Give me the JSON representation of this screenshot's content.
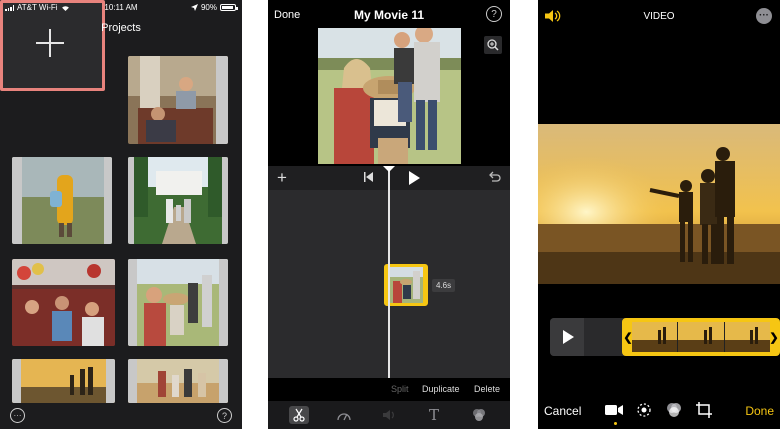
{
  "projects_screen": {
    "status": {
      "carrier": "AT&T Wi-Fi",
      "time": "10:11 AM",
      "battery": "90%"
    },
    "title": "Projects",
    "new_tile_icon": "plus-icon",
    "tiles": [
      {
        "scene": "man lifting child on a sofa"
      },
      {
        "scene": "child in yellow raincoat in a field"
      },
      {
        "scene": "family walking in a garden"
      },
      {
        "scene": "crowd of children with balloons"
      },
      {
        "scene": "family portrait in a meadow"
      },
      {
        "scene": "silhouettes at sunset"
      },
      {
        "scene": "family in autumn grass"
      }
    ],
    "bottom_left_icon": "more-icon",
    "bottom_right_icon": "help-icon",
    "help_glyph": "?",
    "more_glyph": "···",
    "accent": "#e8837d"
  },
  "editor_screen": {
    "done_label": "Done",
    "title": "My Movie 11",
    "help_glyph": "?",
    "clip_duration": "4.6s",
    "actions": [
      "Split",
      "Duplicate",
      "Delete"
    ],
    "tools": [
      "scissors-icon",
      "speed-icon",
      "volume-icon",
      "text-icon",
      "filters-icon"
    ],
    "accent": "#f6c613"
  },
  "video_screen": {
    "title": "VIDEO",
    "cancel_label": "Cancel",
    "done_label": "Done",
    "more_glyph": "···",
    "tools": [
      "video-icon",
      "stabilize-icon",
      "filters-icon",
      "crop-icon"
    ],
    "accent": "#f6c613"
  }
}
